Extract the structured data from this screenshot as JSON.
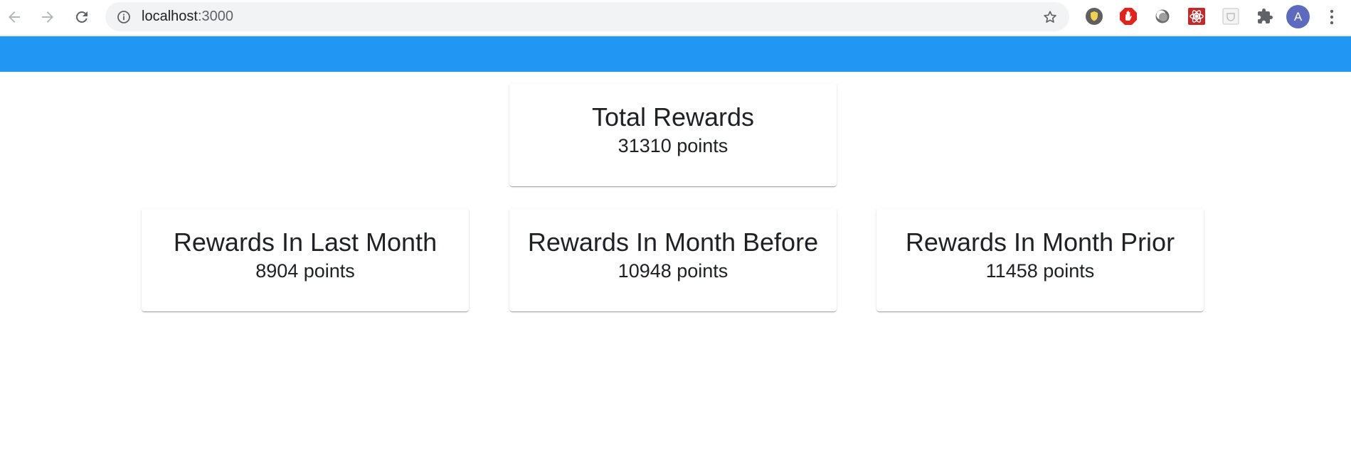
{
  "browser": {
    "url_host": "localhost",
    "url_port": ":3000",
    "profile_initial": "A",
    "icons": {
      "back": "arrow-left-icon",
      "forward": "arrow-right-icon",
      "reload": "reload-icon",
      "info": "info-icon",
      "bookmark": "star-icon",
      "extensions": "puzzle-icon",
      "menu": "kebab-menu-icon"
    }
  },
  "theme": {
    "appbar_color": "#2196f3"
  },
  "rewards": {
    "total": {
      "title": "Total Rewards",
      "value": "31310 points"
    },
    "last_month": {
      "title": "Rewards In Last Month",
      "value": "8904 points"
    },
    "month_before": {
      "title": "Rewards In Month Before",
      "value": "10948 points"
    },
    "month_prior": {
      "title": "Rewards In Month Prior",
      "value": "11458 points"
    }
  }
}
